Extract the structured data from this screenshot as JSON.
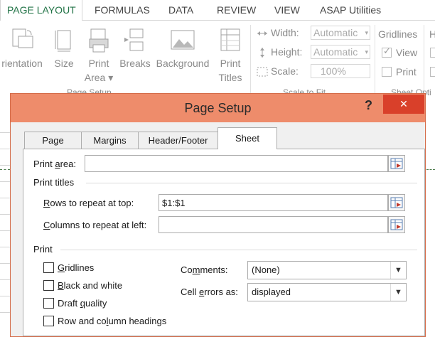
{
  "ribbon_tabs": [
    {
      "label": "PAGE LAYOUT",
      "active": true
    },
    {
      "label": "FORMULAS"
    },
    {
      "label": "DATA"
    },
    {
      "label": "REVIEW"
    },
    {
      "label": "VIEW"
    },
    {
      "label": "ASAP Utilities"
    }
  ],
  "ribbon": {
    "orientation": "rientation",
    "size": "Size",
    "print_area": [
      "Print",
      "Area ▾"
    ],
    "breaks": "Breaks",
    "background": "Background",
    "print_titles": [
      "Print",
      "Titles"
    ],
    "page_setup_group": "Page Setup",
    "width_label": "Width:",
    "width_value": "Automatic",
    "height_label": "Height:",
    "height_value": "Automatic",
    "scale_label": "Scale:",
    "scale_value": "100%",
    "scale_group": "Scale to Fit",
    "gridlines_title": "Gridlines",
    "view_label": "View",
    "print_label": "Print",
    "sheet_options_group": "Sheet Opti",
    "h_label": "H"
  },
  "dialog": {
    "title": "Page Setup",
    "help": "?",
    "close": "✕",
    "tabs": [
      "Page",
      "Margins",
      "Header/Footer",
      "Sheet"
    ],
    "active_tab": "Sheet",
    "print_area_label": {
      "pre": "Print ",
      "u": "a",
      "post": "rea:"
    },
    "print_area_value": "",
    "print_titles_section": "Print titles",
    "rows_label": {
      "pre": "",
      "u": "R",
      "post": "ows to repeat at top:"
    },
    "rows_value": "$1:$1",
    "cols_label": {
      "pre": "",
      "u": "C",
      "post": "olumns to repeat at left:"
    },
    "cols_value": "",
    "print_section": "Print",
    "checkboxes": [
      {
        "pre": "",
        "u": "G",
        "post": "ridlines",
        "checked": false
      },
      {
        "pre": "",
        "u": "B",
        "post": "lack and white",
        "checked": false
      },
      {
        "pre": "Draft ",
        "u": "q",
        "post": "uality",
        "checked": false
      },
      {
        "pre": "Row and co",
        "u": "l",
        "post": "umn headings",
        "checked": false
      }
    ],
    "comments_label": {
      "pre": "Co",
      "u": "m",
      "post": "ments:"
    },
    "comments_value": "(None)",
    "cell_errors_label": {
      "pre": "Cell ",
      "u": "e",
      "post": "rrors as:"
    },
    "cell_errors_value": "displayed"
  },
  "colors": {
    "accent_green": "#217346",
    "dialog_title_bg": "#ee8c6b",
    "close_button": "#d9402a"
  }
}
